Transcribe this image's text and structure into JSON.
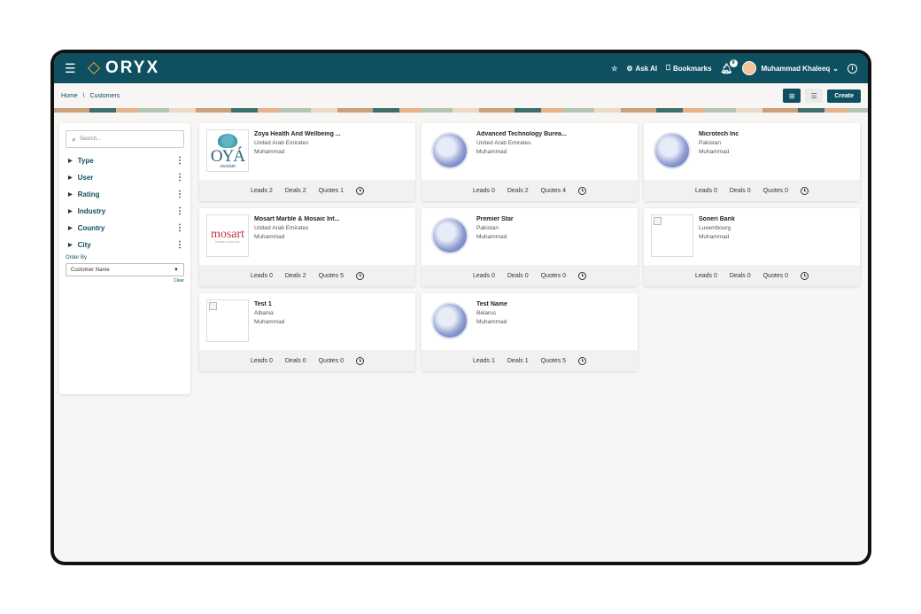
{
  "app": {
    "name": "ORYX"
  },
  "topbar": {
    "ask_ai": "Ask AI",
    "bookmarks": "Bookmarks",
    "notifications_count": "9",
    "user_name": "Muhammad Khaleeq",
    "user_caret": "⌄",
    "info": "i"
  },
  "breadcrumb": {
    "home": "Home",
    "separator": "\\",
    "current": "Customers"
  },
  "toolbar": {
    "create_label": "Create"
  },
  "filters": {
    "search_placeholder": "Search...",
    "items": [
      {
        "label": "Type"
      },
      {
        "label": "User"
      },
      {
        "label": "Rating"
      },
      {
        "label": "Industry"
      },
      {
        "label": "Country"
      },
      {
        "label": "City"
      }
    ],
    "order_by_label": "Order By",
    "order_by_value": "Customer Name",
    "clear_label": "Clear"
  },
  "customers": [
    {
      "name": "Zoya Health And Wellbeing ...",
      "country": "United Arab Emirates",
      "owner": "Muhammad",
      "leads": "Leads 2",
      "deals": "Deals 2",
      "quotes": "Quotes 1",
      "logo": "zoya"
    },
    {
      "name": "Advanced Technology Burea...",
      "country": "United Arab Emirates",
      "owner": "Muhammad",
      "leads": "Leads 0",
      "deals": "Deals 2",
      "quotes": "Quotes 4",
      "logo": "globe"
    },
    {
      "name": "Microtech Inc",
      "country": "Pakistan",
      "owner": "Muhammad",
      "leads": "Leads 0",
      "deals": "Deals 0",
      "quotes": "Quotes 0",
      "logo": "globe"
    },
    {
      "name": "Mosart Marble & Mosaic Int...",
      "country": "United Arab Emirates",
      "owner": "Muhammad",
      "leads": "Leads 0",
      "deals": "Deals 2",
      "quotes": "Quotes 5",
      "logo": "mosart"
    },
    {
      "name": "Premier Star",
      "country": "Pakistan",
      "owner": "Muhammad",
      "leads": "Leads 0",
      "deals": "Deals 0",
      "quotes": "Quotes 0",
      "logo": "globe"
    },
    {
      "name": "Soneri Bank",
      "country": "Luxembourg",
      "owner": "Muhammad",
      "leads": "Leads 0",
      "deals": "Deals 0",
      "quotes": "Quotes 0",
      "logo": "broken"
    },
    {
      "name": "Test 1",
      "country": "Albania",
      "owner": "Muhammad",
      "leads": "Leads 0",
      "deals": "Deals 0",
      "quotes": "Quotes 0",
      "logo": "broken"
    },
    {
      "name": "Test Name",
      "country": "Belarus",
      "owner": "Muhammad",
      "leads": "Leads 1",
      "deals": "Deals 1",
      "quotes": "Quotes 5",
      "logo": "globe"
    }
  ],
  "logo_text": {
    "zoya_main": "OYÁ",
    "zoya_sub": "OF LONGEVITY",
    "mosart_main": "mosart",
    "mosart_sub": "MARBLE & MOSAIC"
  },
  "colors": {
    "primary": "#0e5060",
    "accent": "#d4a24a",
    "background": "#f7f6f4"
  }
}
